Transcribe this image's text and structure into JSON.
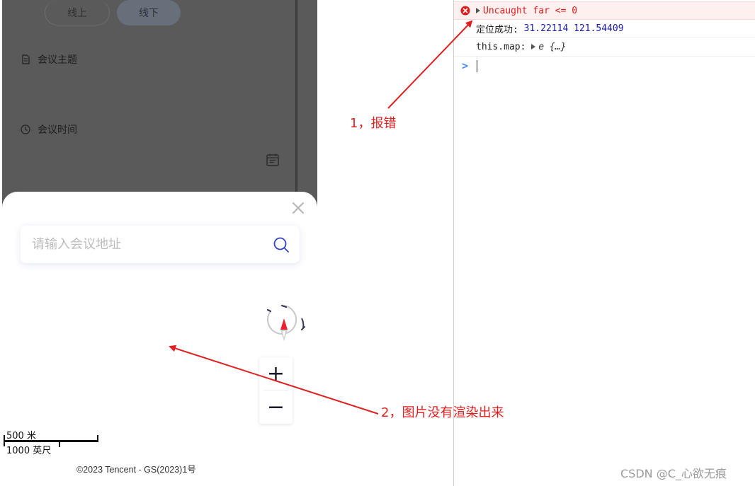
{
  "form": {
    "tab_online": "线上",
    "tab_offline": "线下",
    "topic_label": "会议主题",
    "time_label": "会议时间"
  },
  "map_sheet": {
    "search_placeholder": "请输入会议地址",
    "zoom_in": "+",
    "zoom_out": "−",
    "scale_metric": "500 米",
    "scale_imperial": "1000 英尺",
    "copyright": "©2023 Tencent - GS(2023)1号"
  },
  "console": {
    "error_text": "Uncaught far <= 0",
    "log1_label": "定位成功:",
    "log1_values": "31.22114 121.54409",
    "log2_label": "this.map:",
    "log2_value": "e {…}",
    "prompt": ">"
  },
  "annotations": {
    "note1": "1，报错",
    "note2": "2，图片没有渲染出来"
  },
  "watermark": "CSDN @C_心欲无痕",
  "colors": {
    "annotation": "#e02020",
    "error_bg": "#fff0f0",
    "overlay": "#5a5a5a"
  }
}
